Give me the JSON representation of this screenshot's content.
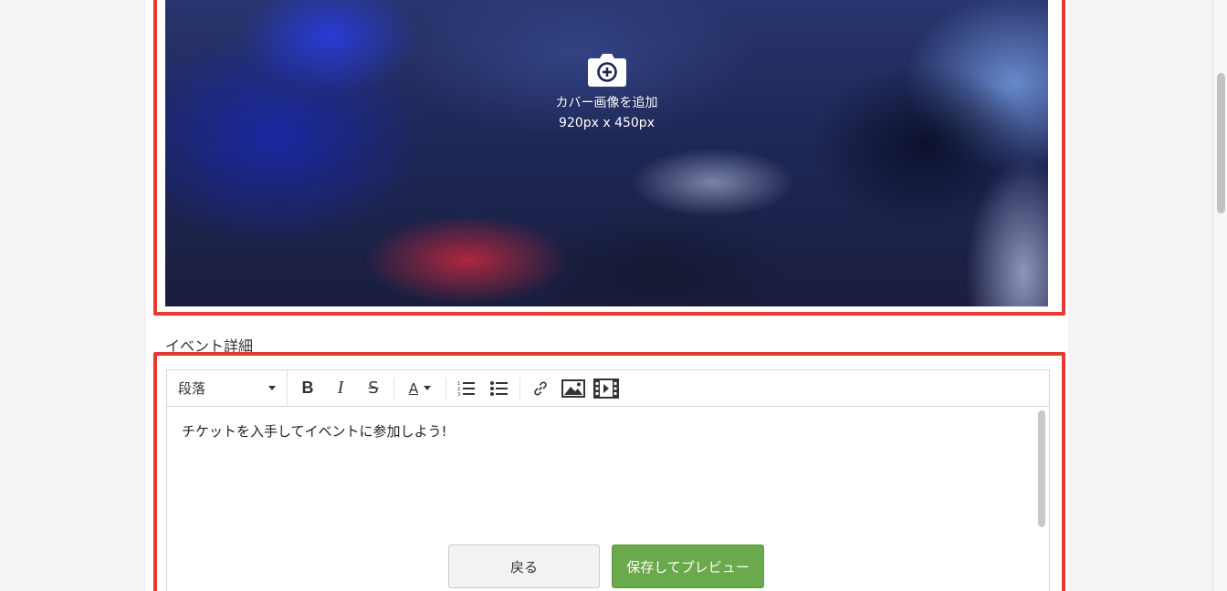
{
  "cover": {
    "add_label": "カバー画像を追加",
    "size_label": "920px x 450px",
    "icon": "camera-plus-icon"
  },
  "details": {
    "section_label": "イベント詳細"
  },
  "editor": {
    "toolbar": {
      "format_selected": "段落",
      "bold": "B",
      "italic": "I",
      "strike": "S",
      "text_color": "A",
      "icons": [
        "ordered-list-icon",
        "bullet-list-icon",
        "link-icon",
        "image-icon",
        "video-icon"
      ]
    },
    "content": "チケットを入手してイベントに参加しよう!"
  },
  "actions": {
    "back_label": "戻る",
    "save_preview_label": "保存してプレビュー"
  },
  "colors": {
    "highlight": "#e53a2f",
    "primary_button": "#6aa94c"
  }
}
